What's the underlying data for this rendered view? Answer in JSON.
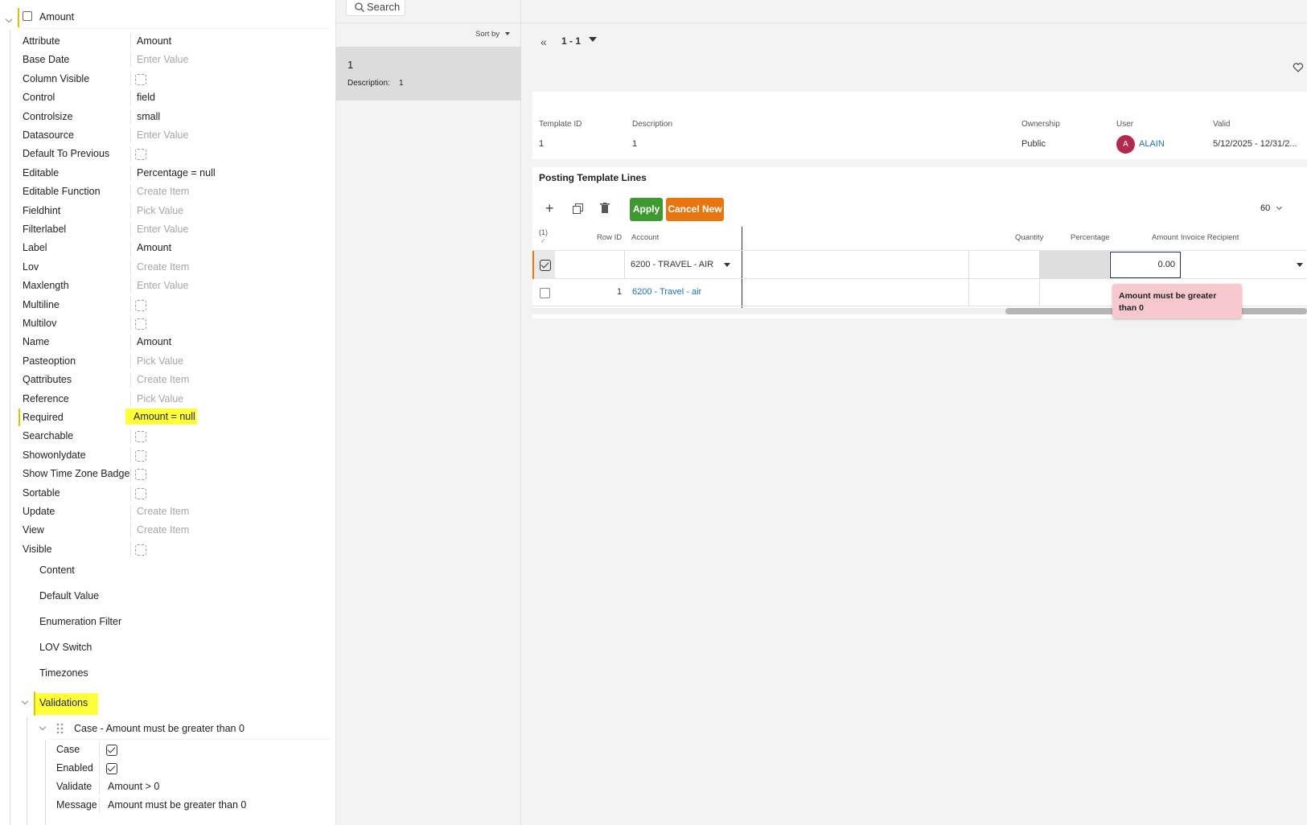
{
  "props_panel": {
    "node_title": "Amount",
    "rows": [
      {
        "key": "Attribute",
        "value": "Amount",
        "kind": "value"
      },
      {
        "key": "Base Date",
        "value": "Enter Value",
        "kind": "placeholder"
      },
      {
        "key": "Column Visible",
        "value": "",
        "kind": "checkbox"
      },
      {
        "key": "Control",
        "value": "field",
        "kind": "value"
      },
      {
        "key": "Controlsize",
        "value": "small",
        "kind": "value"
      },
      {
        "key": "Datasource",
        "value": "Enter Value",
        "kind": "placeholder"
      },
      {
        "key": "Default To Previous",
        "value": "",
        "kind": "checkbox"
      },
      {
        "key": "Editable",
        "value": "Percentage = null",
        "kind": "value"
      },
      {
        "key": "Editable Function",
        "value": "Create Item",
        "kind": "placeholder"
      },
      {
        "key": "Fieldhint",
        "value": "Pick Value",
        "kind": "placeholder"
      },
      {
        "key": "Filterlabel",
        "value": "Enter Value",
        "kind": "placeholder"
      },
      {
        "key": "Label",
        "value": "Amount",
        "kind": "value"
      },
      {
        "key": "Lov",
        "value": "Create Item",
        "kind": "placeholder"
      },
      {
        "key": "Maxlength",
        "value": "Enter Value",
        "kind": "placeholder"
      },
      {
        "key": "Multiline",
        "value": "",
        "kind": "checkbox"
      },
      {
        "key": "Multilov",
        "value": "",
        "kind": "checkbox"
      },
      {
        "key": "Name",
        "value": "Amount",
        "kind": "value"
      },
      {
        "key": "Pasteoption",
        "value": "Pick Value",
        "kind": "placeholder"
      },
      {
        "key": "Qattributes",
        "value": "Create Item",
        "kind": "placeholder"
      },
      {
        "key": "Reference",
        "value": "Pick Value",
        "kind": "placeholder"
      },
      {
        "key": "Required",
        "value": "Amount = null",
        "kind": "highlight"
      },
      {
        "key": "Searchable",
        "value": "",
        "kind": "checkbox"
      },
      {
        "key": "Showonlydate",
        "value": "",
        "kind": "checkbox"
      },
      {
        "key": "Show Time Zone Badge",
        "value": "",
        "kind": "checkbox"
      },
      {
        "key": "Sortable",
        "value": "",
        "kind": "checkbox"
      },
      {
        "key": "Update",
        "value": "Create Item",
        "kind": "placeholder"
      },
      {
        "key": "View",
        "value": "Create Item",
        "kind": "placeholder"
      },
      {
        "key": "Visible",
        "value": "",
        "kind": "checkbox"
      }
    ],
    "sections": [
      "Content",
      "Default Value",
      "Enumeration Filter",
      "LOV Switch",
      "Timezones"
    ],
    "validations_label": "Validations",
    "case_title": "Case - Amount must be greater than 0",
    "case_rows": [
      {
        "key": "Case",
        "value": "",
        "kind": "checked"
      },
      {
        "key": "Enabled",
        "value": "",
        "kind": "checked"
      },
      {
        "key": "Validate",
        "value": "Amount > 0",
        "kind": "value"
      },
      {
        "key": "Message",
        "value": "Amount must be greater than 0",
        "kind": "value"
      }
    ]
  },
  "list_panel": {
    "search_label": "Search",
    "sort_label": "Sort by",
    "item_title": "1",
    "item_desc_label": "Description:",
    "item_desc_value": "1"
  },
  "detail": {
    "pager": "1 - 1",
    "header_cols": [
      "Template ID",
      "Description",
      "Ownership",
      "User",
      "Valid"
    ],
    "header_vals": {
      "template_id": "1",
      "description": "1",
      "ownership": "Public",
      "user_initial": "A",
      "user_name": "ALAIN",
      "valid": "5/12/2025 - 12/31/2..."
    },
    "lines_title": "Posting Template Lines",
    "apply_label": "Apply",
    "cancel_label": "Cancel New",
    "page_size": "60",
    "selected_count": "(1)",
    "columns": [
      "Row ID",
      "Account",
      "Quantity",
      "Percentage",
      "Amount",
      "Invoice Recipient"
    ],
    "edit_row": {
      "account": "6200 - TRAVEL - AIR",
      "amount": "0.00"
    },
    "data_row": {
      "row_id": "1",
      "account": "6200 - Travel - air"
    },
    "error_tooltip": "Amount must be greater than 0",
    "colors": {
      "apply": "#3d9a2f",
      "cancel": "#e8760e",
      "link": "#1b72b9",
      "avatar": "#b3284d",
      "error_bg": "#f7c9cf",
      "highlight": "#ffff3a"
    }
  }
}
